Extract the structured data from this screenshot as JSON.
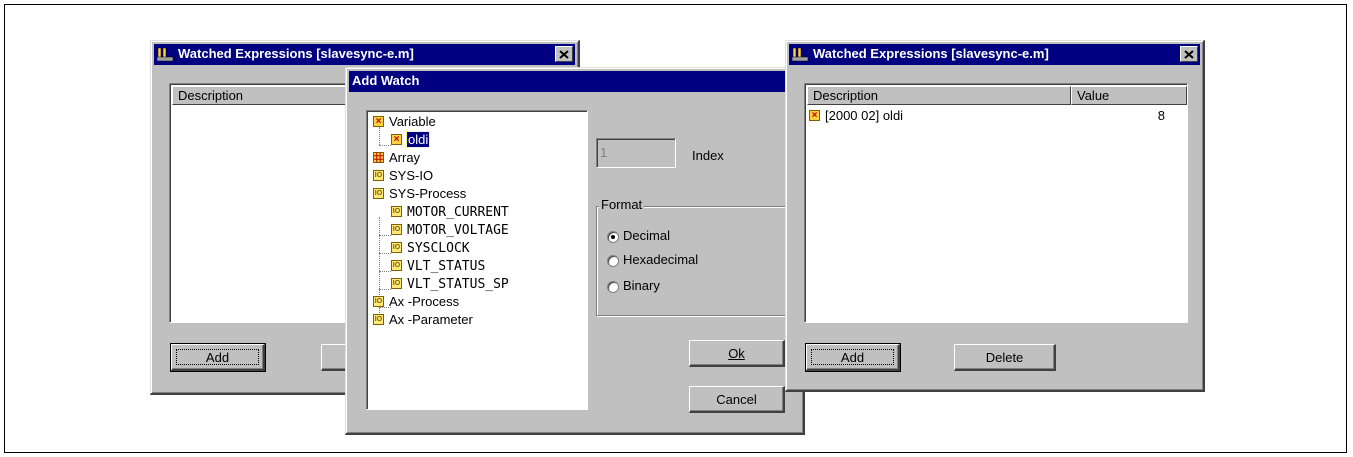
{
  "left_window": {
    "title": "Watched Expressions [slavesync-e.m]",
    "column_description": "Description",
    "add_label": "Add"
  },
  "add_watch": {
    "title": "Add Watch",
    "tree": [
      {
        "label": "Variable",
        "icon": "variable-icon"
      },
      {
        "label": "oldi",
        "icon": "variable-icon",
        "selected": true
      },
      {
        "label": "Array",
        "icon": "array-icon"
      },
      {
        "label": "SYS-IO",
        "icon": "io-icon"
      },
      {
        "label": "SYS-Process",
        "icon": "io-icon"
      },
      {
        "label": "MOTOR_CURRENT",
        "icon": "io-icon"
      },
      {
        "label": "MOTOR_VOLTAGE",
        "icon": "io-icon"
      },
      {
        "label": "SYSCLOCK",
        "icon": "io-icon"
      },
      {
        "label": "VLT_STATUS",
        "icon": "io-icon"
      },
      {
        "label": "VLT_STATUS_SP",
        "icon": "io-icon"
      },
      {
        "label": "Ax -Process",
        "icon": "io-icon"
      },
      {
        "label": "Ax -Parameter",
        "icon": "io-icon"
      }
    ],
    "index_value": "1",
    "index_label": "Index",
    "format_label": "Format",
    "format_options": [
      "Decimal",
      "Hexadecimal",
      "Binary"
    ],
    "format_selected": "Decimal",
    "ok_label": "Ok",
    "cancel_label": "Cancel"
  },
  "right_window": {
    "title": "Watched Expressions [slavesync-e.m]",
    "column_description": "Description",
    "column_value": "Value",
    "rows": [
      {
        "description": "[2000 02] oldi",
        "value": "8"
      }
    ],
    "add_label": "Add",
    "delete_label": "Delete"
  },
  "colors": {
    "titlebar": "#000080",
    "face": "#c0c0c0",
    "selection": "#000080"
  }
}
